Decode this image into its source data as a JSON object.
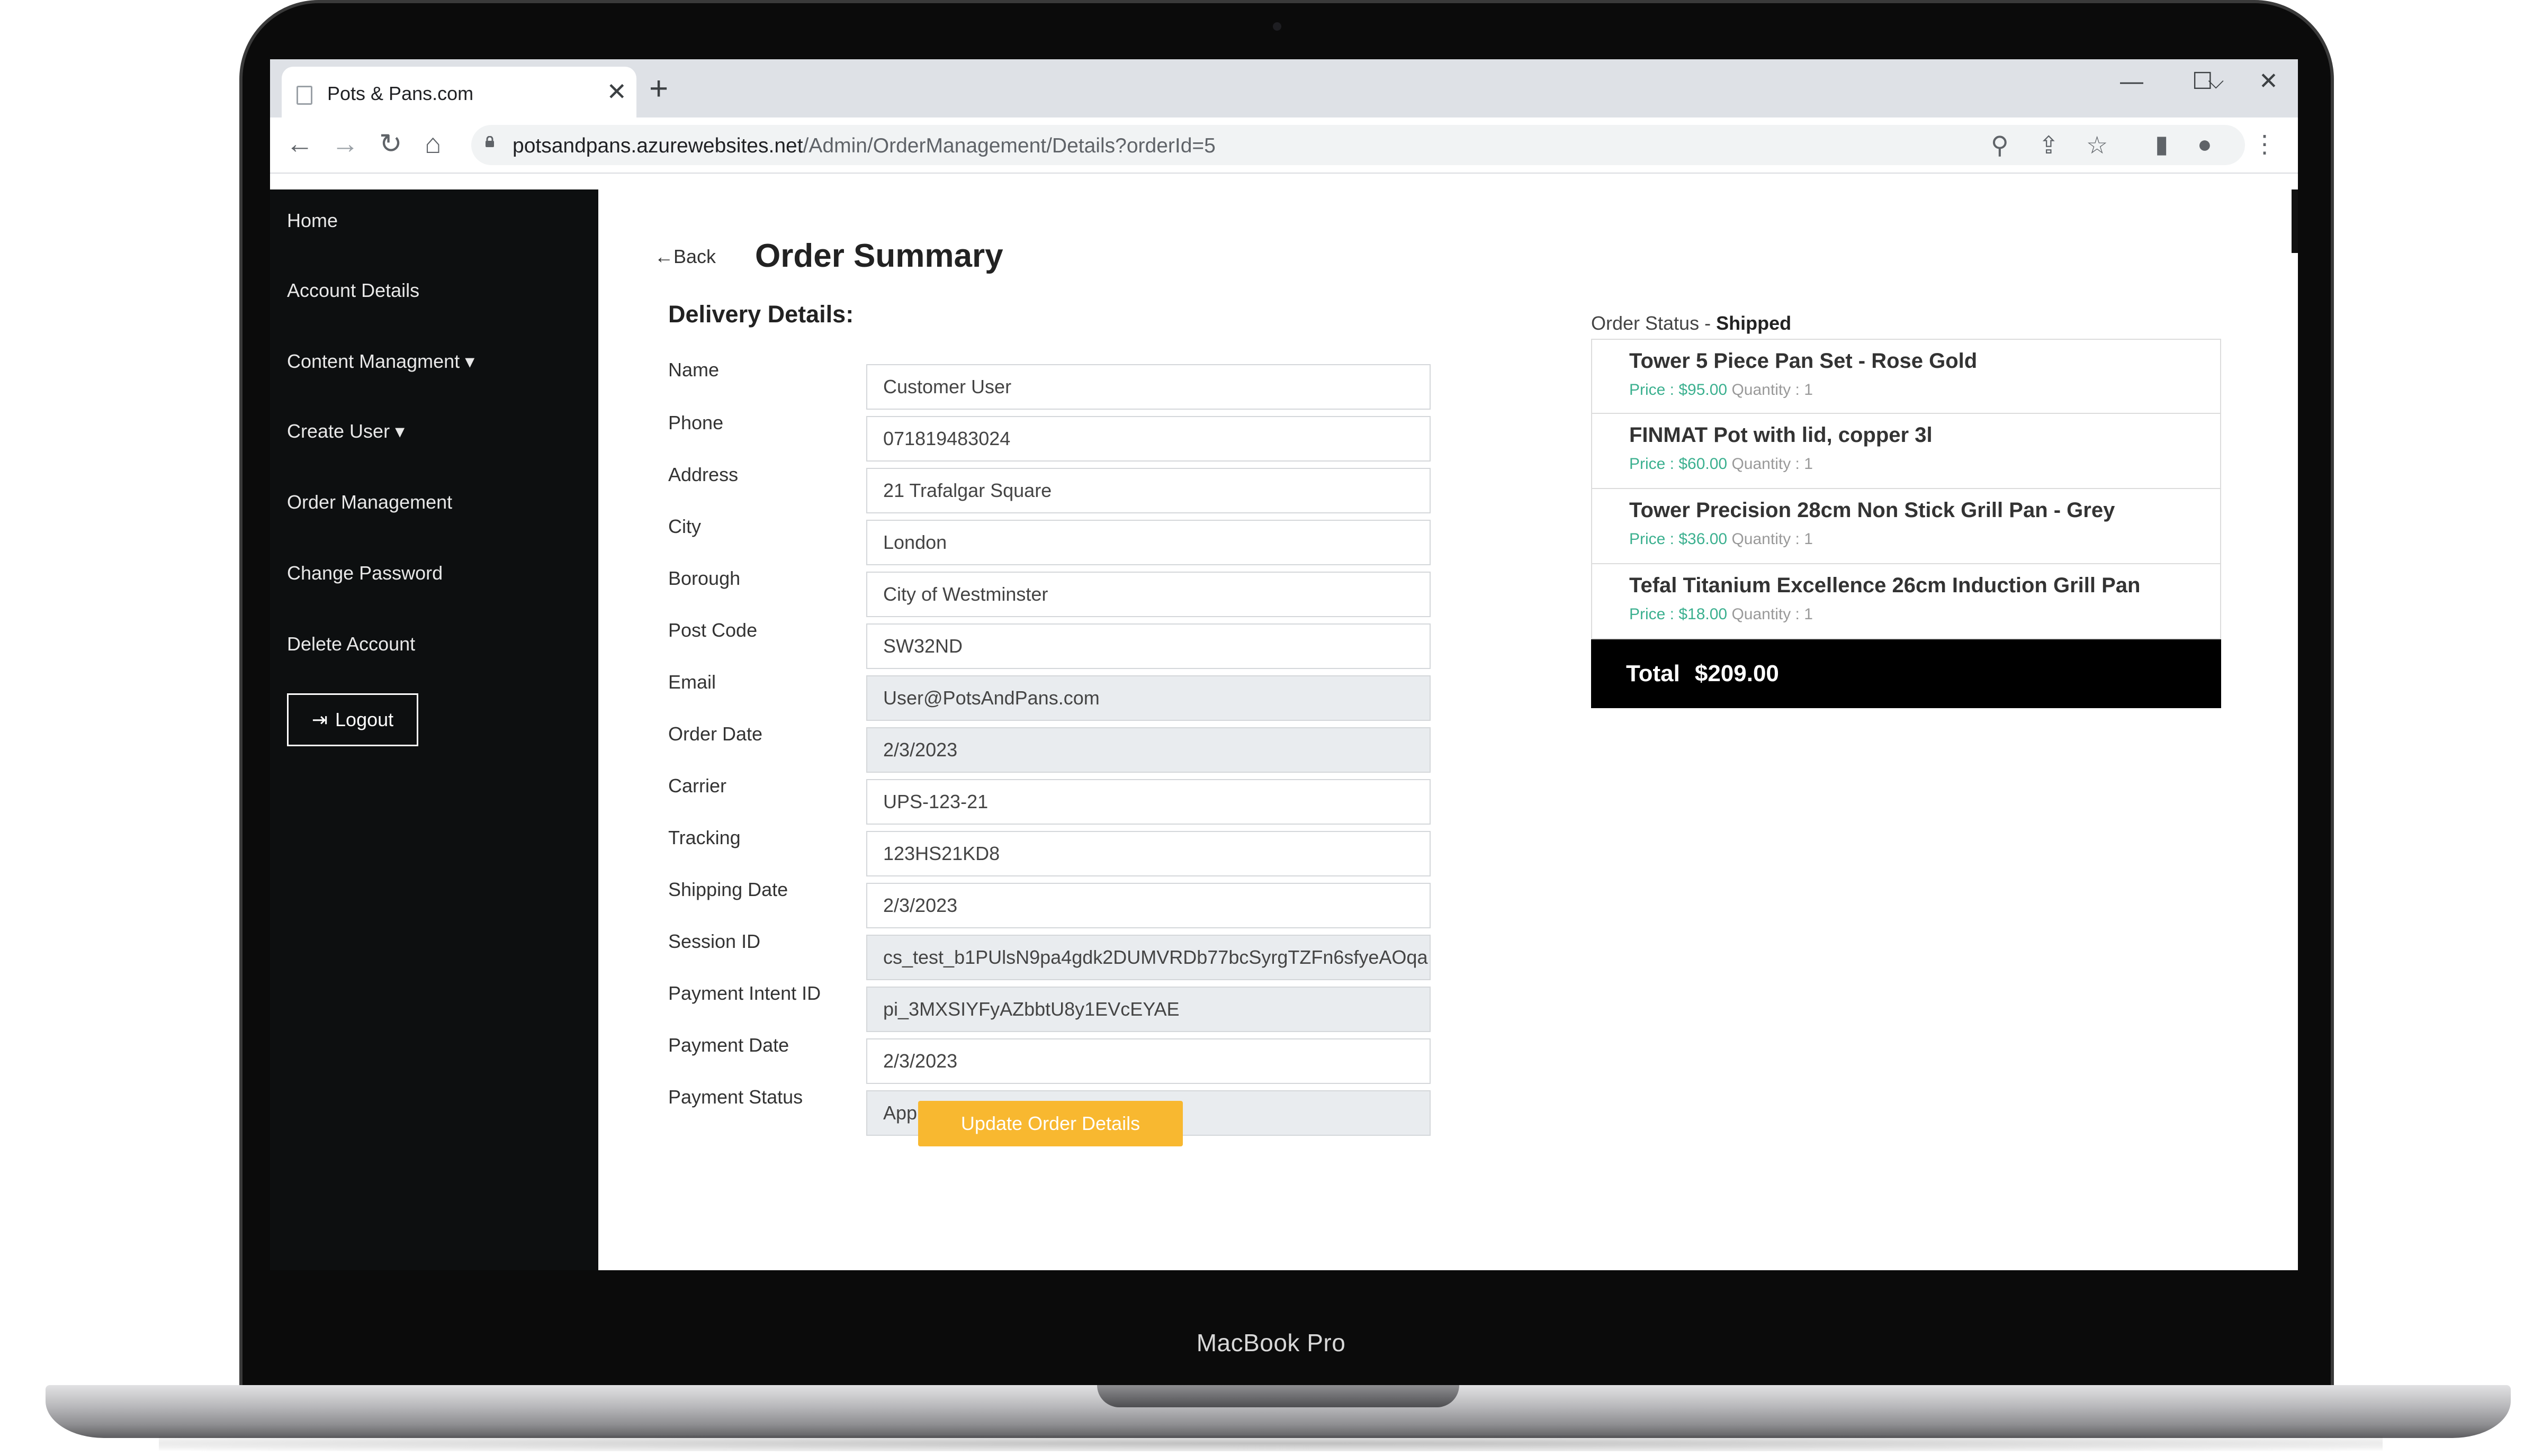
{
  "device": {
    "model_label": "MacBook Pro"
  },
  "browser": {
    "tab_title": "Pots & Pans.com",
    "tab_close": "✕",
    "new_tab": "+",
    "window_controls": {
      "dropdown": "⌵",
      "minimize": "—",
      "maximize": "☐",
      "close": "✕"
    },
    "url_host": "potsandpans.azurewebsites.net",
    "url_path": "/Admin/OrderManagement/Details?orderId=5",
    "nav_icons": {
      "back": "←",
      "forward": "→",
      "reload": "↻",
      "home": "⌂"
    },
    "tool_icons": {
      "zoom": "⚲",
      "share": "⇪",
      "bookmark": "☆",
      "sidebar": "▮",
      "profile": "●",
      "menu": "⋮"
    }
  },
  "sidebar": {
    "items": [
      {
        "label": "Home"
      },
      {
        "label": "Account Details"
      },
      {
        "label": "Content Managment ▾"
      },
      {
        "label": "Create User ▾"
      },
      {
        "label": "Order Management"
      },
      {
        "label": "Change Password"
      },
      {
        "label": "Delete Account"
      }
    ],
    "logout_label": "Logout",
    "logout_icon": "⇥"
  },
  "page": {
    "back_label": "←Back",
    "title": "Order Summary",
    "section_title": "Delivery Details:",
    "fields": [
      {
        "label": "Name",
        "value": "Customer User"
      },
      {
        "label": "Phone",
        "value": "071819483024"
      },
      {
        "label": "Address",
        "value": "21 Trafalgar Square"
      },
      {
        "label": "City",
        "value": "London"
      },
      {
        "label": "Borough",
        "value": "City of Westminster"
      },
      {
        "label": "Post Code",
        "value": "SW32ND"
      },
      {
        "label": "Email",
        "value": "User@PotsAndPans.com"
      },
      {
        "label": "Order Date",
        "value": "2/3/2023"
      },
      {
        "label": "Carrier",
        "value": "UPS-123-21"
      },
      {
        "label": "Tracking",
        "value": "123HS21KD8"
      },
      {
        "label": "Shipping Date",
        "value": "2/3/2023"
      },
      {
        "label": "Session ID",
        "value": "cs_test_b1PUlsN9pa4gdk2DUMVRDb77bcSyrgTZFn6sfyeAOqa"
      },
      {
        "label": "Payment Intent ID",
        "value": "pi_3MXSIYFyAZbbtU8y1EVcEYAE"
      },
      {
        "label": "Payment Date",
        "value": "2/3/2023"
      },
      {
        "label": "Payment Status",
        "value": "Approved"
      }
    ],
    "update_button": "Update Order Details"
  },
  "order": {
    "status_prefix": "Order Status - ",
    "status": "Shipped",
    "items": [
      {
        "name": "Tower 5 Piece Pan Set - Rose Gold",
        "price": "Price : $95.00",
        "quantity": "Quantity : 1"
      },
      {
        "name": "FINMAT Pot with lid, copper 3l",
        "price": "Price : $60.00",
        "quantity": "Quantity : 1"
      },
      {
        "name": "Tower Precision 28cm Non Stick Grill Pan - Grey",
        "price": "Price : $36.00",
        "quantity": "Quantity : 1"
      },
      {
        "name": "Tefal Titanium Excellence 26cm Induction Grill Pan",
        "price": "Price : $18.00",
        "quantity": "Quantity : 1"
      }
    ],
    "total_label": "Total",
    "total_value": "$209.00"
  }
}
